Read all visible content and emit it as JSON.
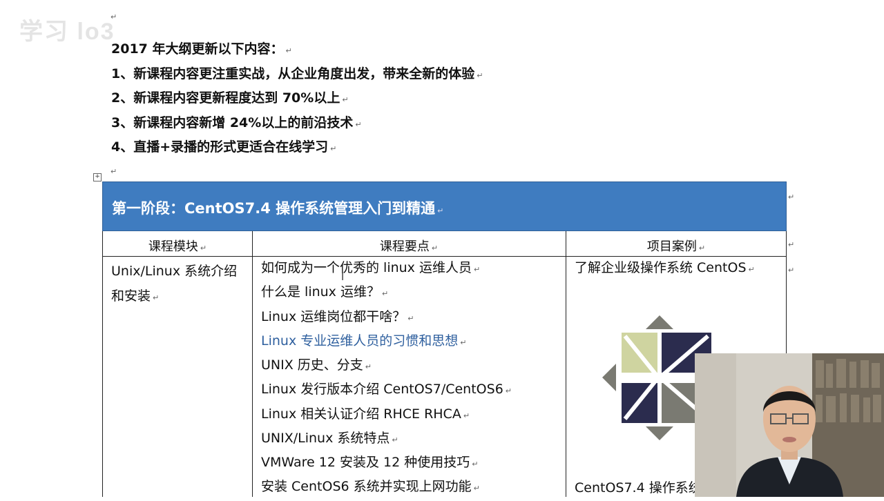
{
  "watermark": "学习 lo3",
  "intro": {
    "title": "2017 年大纲更新以下内容：",
    "items": [
      "1、新课程内容更注重实战，从企业角度出发，带来全新的体验",
      "2、新课程内容更新程度达到 70%以上",
      "3、新课程内容新增 24%以上的前沿技术",
      "4、直播+录播的形式更适合在线学习"
    ]
  },
  "para_mark": "↵",
  "stage": {
    "title": "第一阶段：CentOS7.4 操作系统管理入门到精通"
  },
  "table": {
    "headers": [
      "课程模块",
      "课程要点",
      "项目案例"
    ],
    "module": [
      "Unix/Linux 系统介绍",
      "和安装"
    ],
    "points": [
      "如何成为一个优秀的 linux 运维人员",
      "什么是 linux 运维？",
      "Linux 运维岗位都干啥？",
      "Linux 专业运维人员的习惯和思想",
      "UNIX 历史、分支",
      "Linux 发行版本介绍 CentOS7/CentOS6",
      "Linux 相关认证介绍   RHCE RHCA",
      "UNIX/Linux 系统特点",
      "VMWare 12 安装及 12 种使用技巧",
      "安装 CentOS6 系统并实现上网功能"
    ],
    "case1": "了解企业级操作系统 CentOS",
    "case2": "CentOS7.4 操作系统"
  },
  "colors": {
    "stage_header_bg": "#3f7cc0",
    "blue_point": "#2e5f9e"
  },
  "icons": {
    "logo": "centos-logo-icon",
    "anchor": "table-move-handle-icon"
  }
}
